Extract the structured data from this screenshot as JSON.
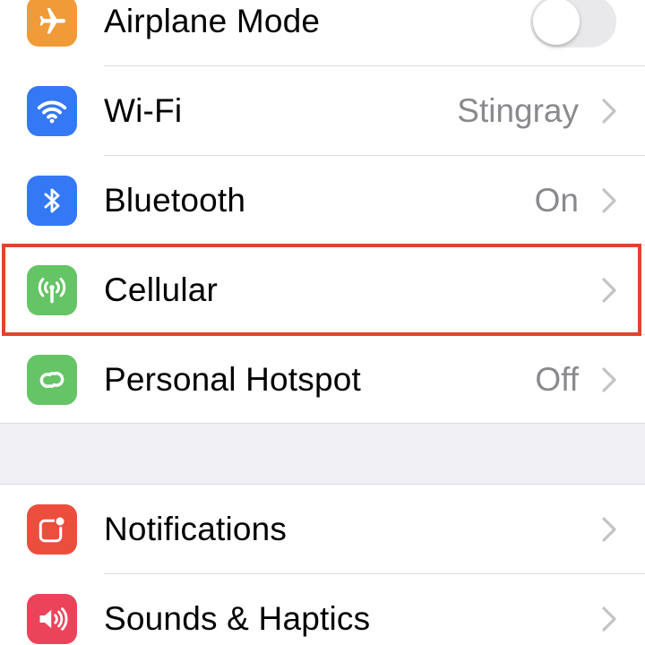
{
  "colors": {
    "airplane": "#f19a38",
    "wifi": "#3478f6",
    "bluetooth": "#3478f6",
    "cellular": "#65c466",
    "hotspot": "#65c466",
    "notifications": "#eb4e3d",
    "sounds": "#eb445a",
    "highlight": "#e0452c"
  },
  "group1": {
    "airplane": {
      "label": "Airplane Mode",
      "icon": "airplane-icon",
      "toggle_on": false
    },
    "wifi": {
      "label": "Wi-Fi",
      "value": "Stingray",
      "icon": "wifi-icon"
    },
    "bluetooth": {
      "label": "Bluetooth",
      "value": "On",
      "icon": "bluetooth-icon"
    },
    "cellular": {
      "label": "Cellular",
      "icon": "cellular-antenna-icon"
    },
    "hotspot": {
      "label": "Personal Hotspot",
      "value": "Off",
      "icon": "hotspot-link-icon"
    }
  },
  "group2": {
    "notifications": {
      "label": "Notifications",
      "icon": "notifications-icon"
    },
    "sounds": {
      "label": "Sounds & Haptics",
      "icon": "speaker-icon"
    }
  }
}
